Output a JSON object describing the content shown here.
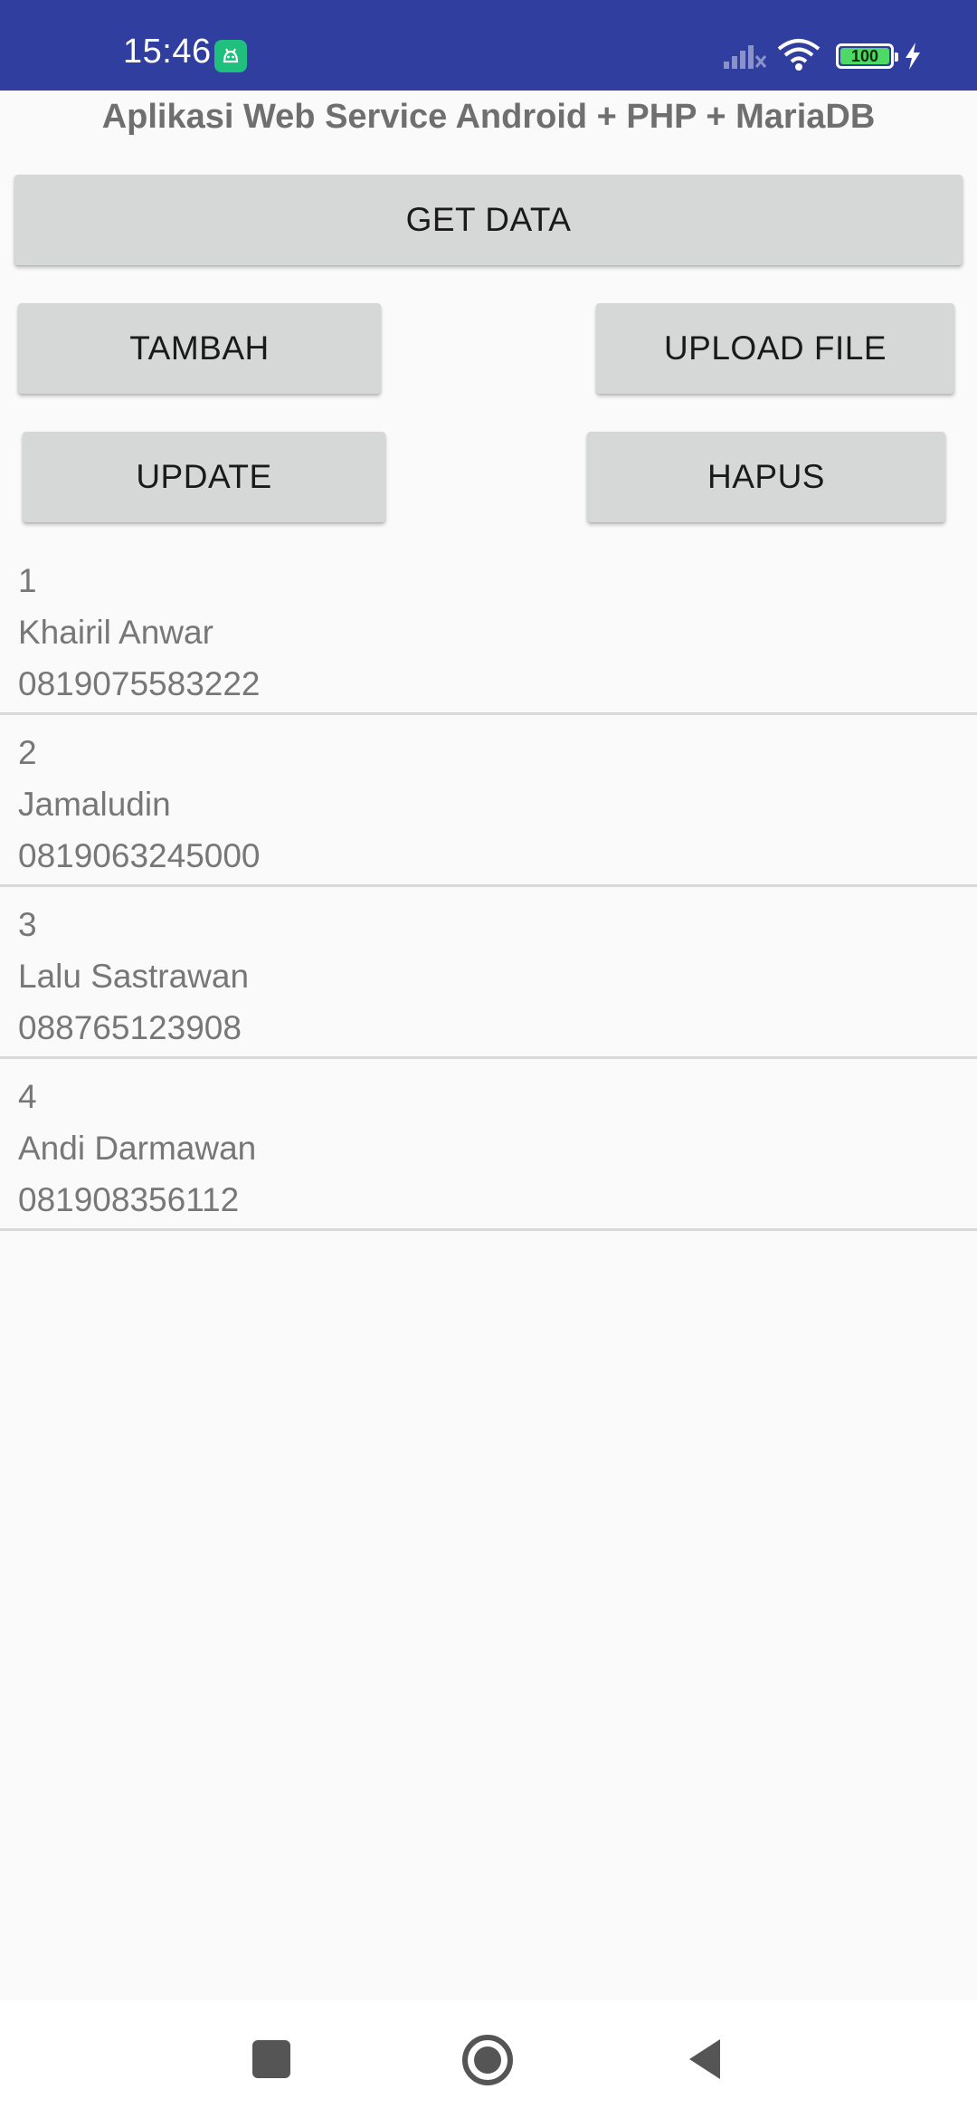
{
  "status_bar": {
    "time": "15:46",
    "battery_level": "100",
    "notification_icon": "android-face-icon",
    "signal_icon": "cell-signal-off-icon",
    "wifi_icon": "wifi-icon",
    "charging_icon": "lightning-icon",
    "background_color": "#303f9f"
  },
  "app": {
    "title": "Aplikasi Web Service Android + PHP + MariaDB"
  },
  "buttons": {
    "get_data": "GET DATA",
    "tambah": "TAMBAH",
    "upload_file": "UPLOAD FILE",
    "update": "UPDATE",
    "hapus": "HAPUS"
  },
  "records": [
    {
      "id": "1",
      "name": "Khairil Anwar",
      "phone": "0819075583222"
    },
    {
      "id": "2",
      "name": "Jamaludin",
      "phone": "0819063245000"
    },
    {
      "id": "3",
      "name": "Lalu Sastrawan",
      "phone": "088765123908"
    },
    {
      "id": "4",
      "name": "Andi Darmawan",
      "phone": "081908356112"
    }
  ],
  "nav_bar": {
    "recents_icon": "square-icon",
    "home_icon": "circle-icon",
    "back_icon": "triangle-back-icon"
  }
}
